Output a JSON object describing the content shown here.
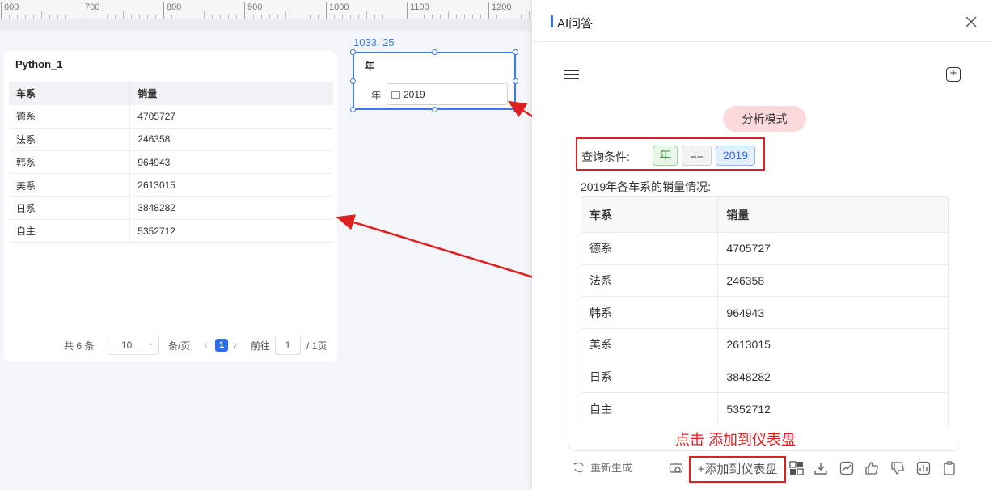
{
  "ruler": {
    "labels": [
      "600",
      "700",
      "800",
      "900",
      "1000",
      "1100",
      "1200"
    ]
  },
  "widget_position": "1033, 25",
  "python_card": {
    "title": "Python_1",
    "columns": [
      "车系",
      "销量"
    ],
    "rows": [
      [
        "德系",
        "4705727"
      ],
      [
        "法系",
        "246358"
      ],
      [
        "韩系",
        "964943"
      ],
      [
        "美系",
        "2613015"
      ],
      [
        "日系",
        "3848282"
      ],
      [
        "自主",
        "5352712"
      ]
    ],
    "pager": {
      "total": "共 6 条",
      "page_size": "10",
      "per_page": "条/页",
      "current": "1",
      "goto_label": "前往",
      "goto_value": "1",
      "total_pages": "/ 1页"
    }
  },
  "year_filter": {
    "title": "年",
    "label": "年",
    "value": "2019"
  },
  "ai_panel": {
    "title": "AI问答",
    "mode_label": "分析模式",
    "condition": {
      "label": "查询条件:",
      "field": "年",
      "operator": "==",
      "value": "2019"
    },
    "description": "2019年各车系的销量情况:",
    "columns": [
      "车系",
      "销量"
    ],
    "rows": [
      [
        "德系",
        "4705727"
      ],
      [
        "法系",
        "246358"
      ],
      [
        "韩系",
        "964943"
      ],
      [
        "美系",
        "2613015"
      ],
      [
        "日系",
        "3848282"
      ],
      [
        "自主",
        "5352712"
      ]
    ],
    "callout": "点击 添加到仪表盘",
    "regenerate_label": "重新生成",
    "add_label": "+添加到仪表盘"
  },
  "colors": {
    "accent": "#2f6fed",
    "annotation": "#e02020",
    "mode_bg": "#fbd9dd"
  }
}
